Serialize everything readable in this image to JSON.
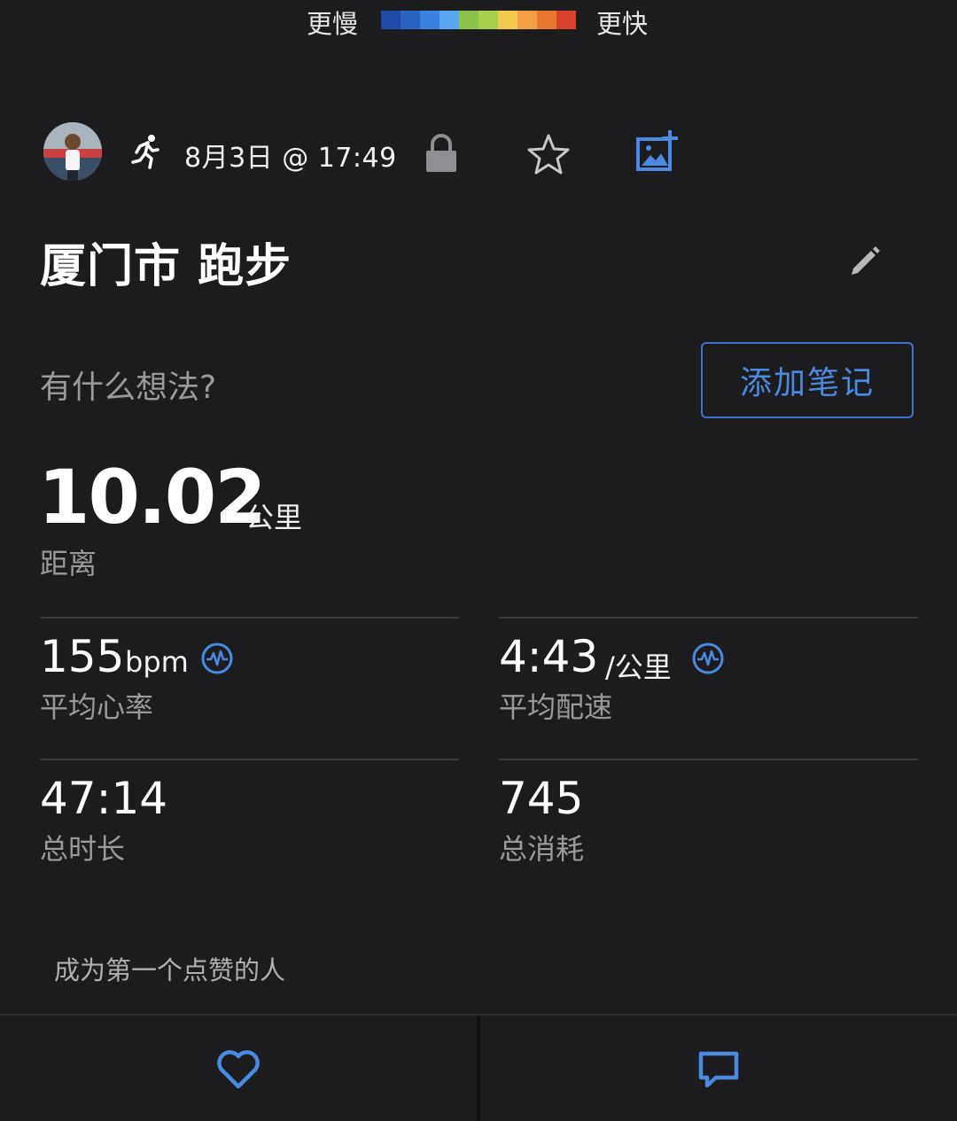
{
  "pace_legend": {
    "slow_label": "更慢",
    "fast_label": "更快",
    "colors": [
      "#1f4aa8",
      "#2a63c4",
      "#3b82e0",
      "#5aa6f0",
      "#8bc34a",
      "#a8d04a",
      "#f2c94c",
      "#f0a040",
      "#e8762e",
      "#d9412c"
    ]
  },
  "header": {
    "activity_icon": "running-icon",
    "date_time": "8月3日 @ 17:49",
    "privacy_icon": "lock-icon",
    "favorite_icon": "star-icon",
    "add_photo_icon": "add-photo-icon"
  },
  "activity": {
    "title": "厦门市 跑步",
    "edit_icon": "pencil-icon"
  },
  "notes": {
    "prompt": "有什么想法?",
    "add_button": "添加笔记"
  },
  "distance": {
    "value": "10.02",
    "unit": "公里",
    "label": "距离"
  },
  "stats": {
    "heart_rate": {
      "value": "155",
      "unit": "bpm",
      "label": "平均心率"
    },
    "pace": {
      "value": "4:43",
      "unit": "/公里",
      "label": "平均配速"
    },
    "duration": {
      "value": "47:14",
      "label": "总时长"
    },
    "calories": {
      "value": "745",
      "label": "总消耗"
    }
  },
  "kudos_text": "成为第一个点赞的人",
  "actions": {
    "like_icon": "heart-icon",
    "comment_icon": "comment-icon"
  },
  "colors": {
    "background": "#1c1c1e",
    "accent_blue": "#4a8ae0",
    "muted_text": "#9a9a9e"
  }
}
